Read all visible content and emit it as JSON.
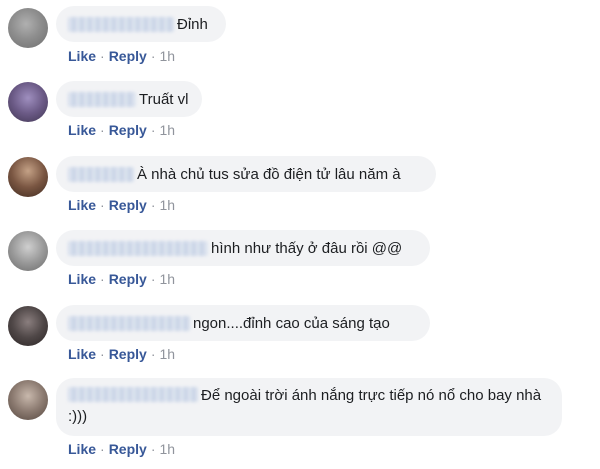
{
  "actions": {
    "like_label": "Like",
    "reply_label": "Reply",
    "separator": "·"
  },
  "comments": [
    {
      "text": "Đỉnh",
      "time": "1h",
      "avatar_color": "#8e8e8e"
    },
    {
      "text": "Truất vl",
      "time": "1h",
      "avatar_color": "#6b5a86"
    },
    {
      "text": "À nhà chủ tus sửa đồ điện tử lâu năm à",
      "time": "1h",
      "avatar_color": "#7a5642"
    },
    {
      "text": "hình như thấy ở đâu rồi @@",
      "time": "1h",
      "avatar_color": "#9a9a9a"
    },
    {
      "text": "ngon....đỉnh cao của sáng tạo",
      "time": "1h",
      "avatar_color": "#4f4747"
    },
    {
      "text": "Để ngoài trời ánh nắng trực tiếp nó nổ cho bay nhà :)))",
      "time": "1h",
      "avatar_color": "#8b7a70"
    }
  ],
  "colors": {
    "bubble_bg": "#f2f3f5",
    "action_link": "#385898",
    "meta_text": "#90949c",
    "body_text": "#1c1e21"
  }
}
